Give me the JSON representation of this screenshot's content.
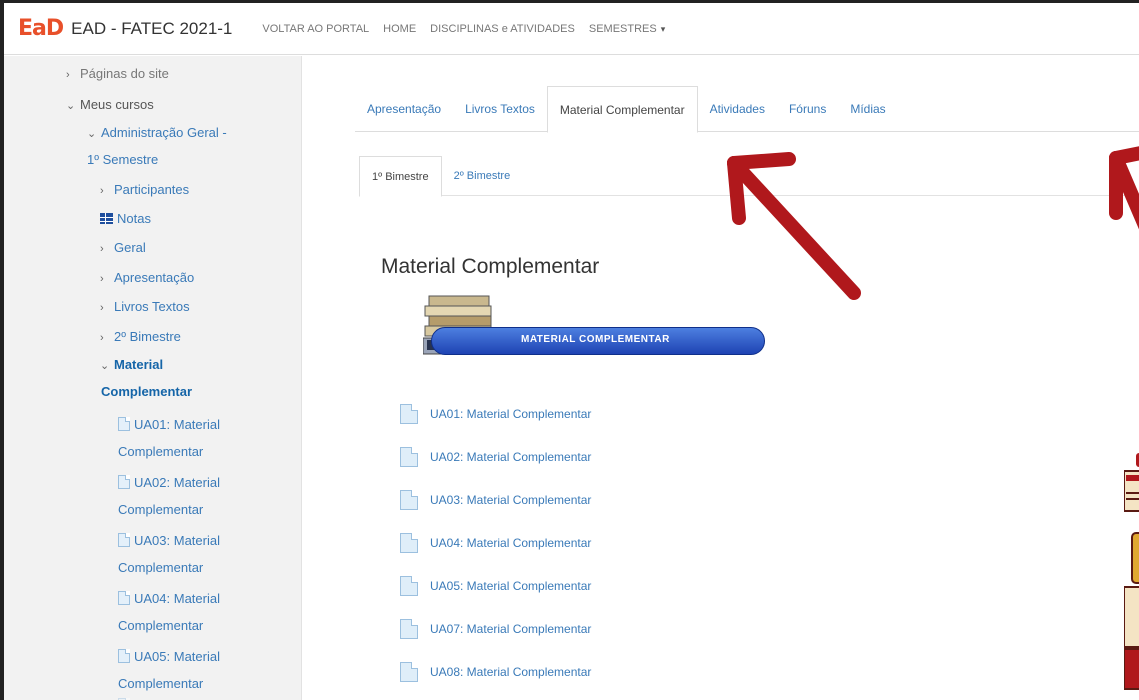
{
  "navbar": {
    "logo": "EaD",
    "brand": "EAD - FATEC 2021-1",
    "links": [
      "VOLTAR AO PORTAL",
      "HOME",
      "DISCIPLINAS e ATIVIDADES",
      "SEMESTRES"
    ],
    "caret": "▾"
  },
  "sidebar": {
    "cut_top": "Páginas do site",
    "meus_cursos": "Meus cursos",
    "course_line1": "Administração Geral -",
    "course_line2": "1º Semestre",
    "participantes": "Participantes",
    "notas": "Notas",
    "geral": "Geral",
    "apresentacao": "Apresentação",
    "livros": "Livros Textos",
    "bimestre2": "2º Bimestre",
    "material_line1": "Material",
    "material_line2": "Complementar",
    "ua_items": [
      {
        "line1": "UA01: Material",
        "line2": "Complementar"
      },
      {
        "line1": "UA02: Material",
        "line2": "Complementar"
      },
      {
        "line1": "UA03: Material",
        "line2": "Complementar"
      },
      {
        "line1": "UA04: Material",
        "line2": "Complementar"
      },
      {
        "line1": "UA05: Material",
        "line2": "Complementar"
      }
    ]
  },
  "tabs": [
    "Apresentação",
    "Livros Textos",
    "Material Complementar",
    "Atividades",
    "Fóruns",
    "Mídias"
  ],
  "subtabs": [
    "1º Bimestre",
    "2º Bimestre"
  ],
  "heading": "Material Complementar",
  "banner_text": "MATERIAL COMPLEMENTAR",
  "ua_list": [
    "UA01: Material Complementar",
    "UA02: Material Complementar",
    "UA03: Material Complementar",
    "UA04: Material Complementar",
    "UA05: Material Complementar",
    "UA07: Material Complementar",
    "UA08: Material Complementar"
  ],
  "colors": {
    "link": "#3a7ab8",
    "arrow": "#b0181c",
    "logo": "#e8502a"
  }
}
